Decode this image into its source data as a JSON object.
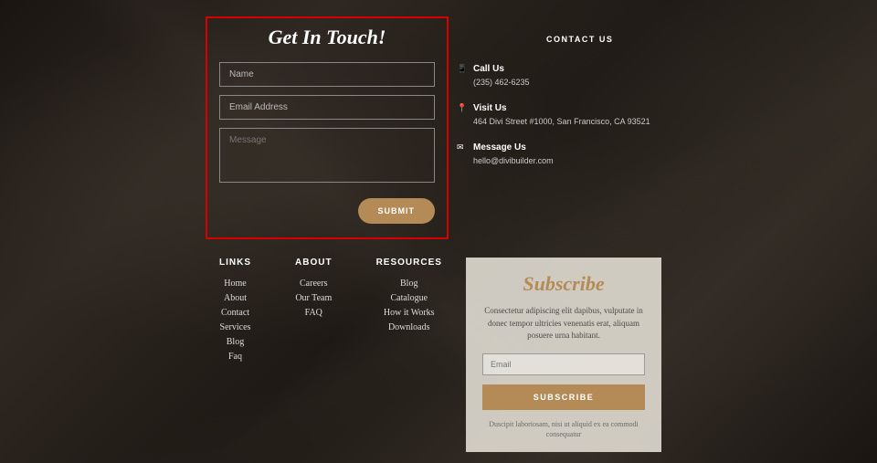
{
  "form": {
    "title": "Get In Touch!",
    "name_placeholder": "Name",
    "email_placeholder": "Email Address",
    "message_placeholder": "Message",
    "submit_label": "SUBMIT"
  },
  "contact": {
    "header": "CONTACT US",
    "items": [
      {
        "icon": "📱",
        "title": "Call Us",
        "detail": "(235) 462-6235"
      },
      {
        "icon": "📍",
        "title": "Visit Us",
        "detail": "464 Divi Street #1000, San Francisco, CA 93521"
      },
      {
        "icon": "✉",
        "title": "Message Us",
        "detail": "hello@divibuilder.com"
      }
    ]
  },
  "footer_links": {
    "cols": [
      {
        "header": "LINKS",
        "items": [
          "Home",
          "About",
          "Contact",
          "Services",
          "Blog",
          "Faq"
        ]
      },
      {
        "header": "ABOUT",
        "items": [
          "Careers",
          "Our Team",
          "FAQ"
        ]
      },
      {
        "header": "RESOURCES",
        "items": [
          "Blog",
          "Catalogue",
          "How it Works",
          "Downloads"
        ]
      }
    ]
  },
  "subscribe": {
    "title": "Subscribe",
    "desc": "Consectetur adipiscing elit dapibus, vulputate in donec tempor ultricies venenatis erat, aliquam posuere urna habitant.",
    "email_placeholder": "Email",
    "button_label": "SUBSCRIBE",
    "footnote": "Duscipit laboriosam, nisi ut aliquid ex ea commodi consequatur"
  }
}
